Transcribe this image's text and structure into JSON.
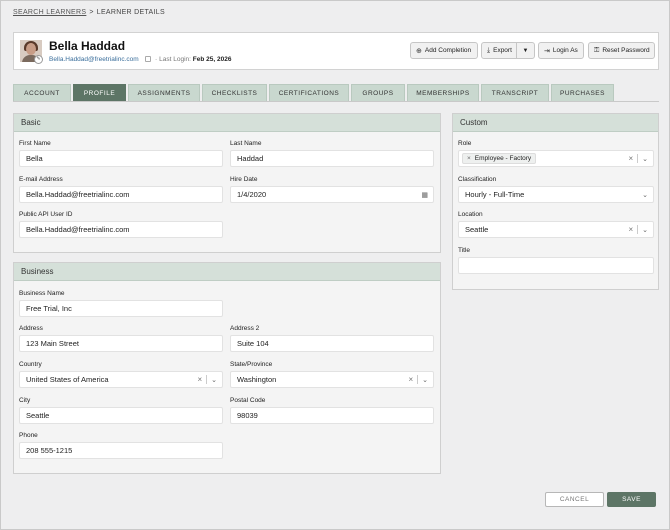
{
  "breadcrumb": {
    "link": "SEARCH LEARNERS",
    "separator": ">",
    "current": "LEARNER DETAILS"
  },
  "learner": {
    "name": "Bella Haddad",
    "email": "Bella.Haddad@freetrialinc.com",
    "last_login_label": "Last Login:",
    "last_login": "Feb 25, 2026"
  },
  "actions": {
    "add_completion": "Add Completion",
    "export": "Export",
    "login_as": "Login As",
    "reset_password": "Reset Password"
  },
  "tabs": [
    "ACCOUNT",
    "PROFILE",
    "ASSIGNMENTS",
    "CHECKLISTS",
    "CERTIFICATIONS",
    "GROUPS",
    "MEMBERSHIPS",
    "TRANSCRIPT",
    "PURCHASES"
  ],
  "active_tab": "PROFILE",
  "basic": {
    "title": "Basic",
    "first_name_label": "First Name",
    "first_name": "Bella",
    "last_name_label": "Last Name",
    "last_name": "Haddad",
    "email_label": "E-mail Address",
    "email": "Bella.Haddad@freetrialinc.com",
    "hire_date_label": "Hire Date",
    "hire_date": "1/4/2020",
    "api_id_label": "Public API User ID",
    "api_id": "Bella.Haddad@freetrialinc.com"
  },
  "business": {
    "title": "Business",
    "name_label": "Business Name",
    "name": "Free Trial, Inc",
    "address_label": "Address",
    "address": "123 Main Street",
    "address2_label": "Address 2",
    "address2": "Suite 104",
    "country_label": "Country",
    "country": "United States of America",
    "state_label": "State/Province",
    "state": "Washington",
    "city_label": "City",
    "city": "Seattle",
    "postal_label": "Postal Code",
    "postal": "98039",
    "phone_label": "Phone",
    "phone": "208 555-1215"
  },
  "custom": {
    "title": "Custom",
    "role_label": "Role",
    "role": "Employee - Factory",
    "classification_label": "Classification",
    "classification": "Hourly - Full-Time",
    "location_label": "Location",
    "location": "Seattle",
    "title_label": "Title",
    "title_value": ""
  },
  "footer": {
    "cancel": "CANCEL",
    "save": "SAVE"
  },
  "colors": {
    "accent": "#5d7566",
    "tab_bg": "#c9d8cf",
    "panel_head": "#d5e0d9"
  },
  "icons": {
    "add_completion": "plus-circle-icon",
    "export": "download-icon",
    "login_as": "login-icon",
    "reset_password": "key-icon",
    "hire_date": "calendar-icon"
  }
}
